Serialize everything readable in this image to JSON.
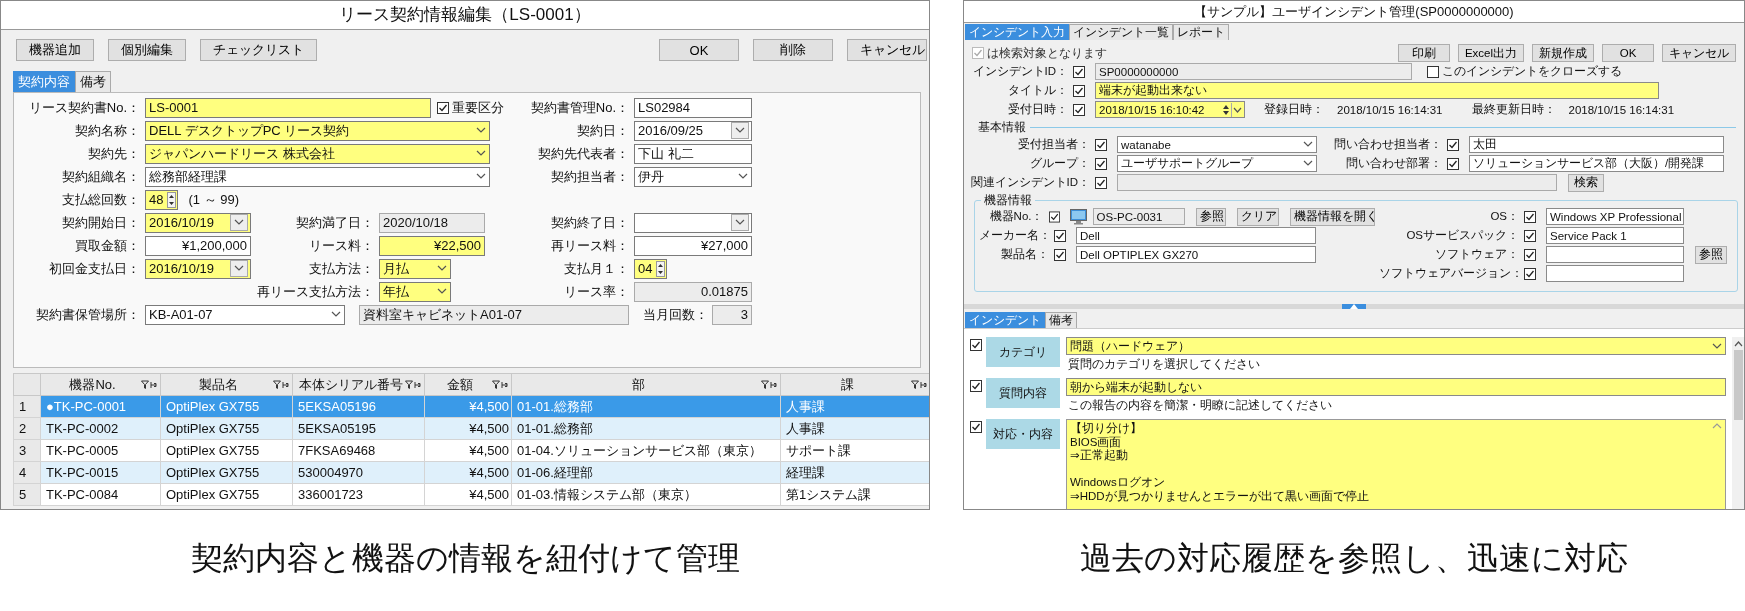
{
  "contract_window": {
    "title": "リース契約情報編集（LS-0001）",
    "toolbar_left": [
      "機器追加",
      "個別編集",
      "チェックリスト"
    ],
    "toolbar_right": [
      "OK",
      "削除",
      "キャンセル"
    ],
    "tabs": [
      {
        "label": "契約内容",
        "selected": true
      },
      {
        "label": "備考",
        "selected": false
      }
    ],
    "form_rows": [
      {
        "left": {
          "label": "リース契約書No.：",
          "field": {
            "kind": "text",
            "value": "LS-0001",
            "highlighted": true,
            "readonly": false
          },
          "flag": {
            "label": "重要区分",
            "checked": true
          }
        },
        "right": {
          "label": "契約書管理No.：",
          "field": {
            "kind": "text",
            "value": "LS02984",
            "highlighted": false,
            "readonly": false
          }
        }
      },
      {
        "left": {
          "label": "契約名称：",
          "field": {
            "kind": "combo",
            "value": "DELL  デスクトップPC  リース契約",
            "highlighted": true,
            "readonly": false
          }
        },
        "right": {
          "label": "契約日：",
          "field": {
            "kind": "date",
            "value": "2016/09/25",
            "highlighted": false,
            "readonly": false
          }
        }
      },
      {
        "left": {
          "label": "契約先：",
          "field": {
            "kind": "combo",
            "value": "ジャパンハードリース  株式会社",
            "highlighted": true,
            "readonly": false
          }
        },
        "right": {
          "label": "契約先代表者：",
          "field": {
            "kind": "text",
            "value": "下山  礼二",
            "highlighted": false,
            "readonly": false
          }
        }
      },
      {
        "left": {
          "label": "契約組織名：",
          "field": {
            "kind": "combo",
            "value": "総務部経理課",
            "highlighted": false,
            "readonly": false
          }
        },
        "right": {
          "label": "契約担当者：",
          "field": {
            "kind": "combo",
            "value": "伊丹",
            "highlighted": false,
            "readonly": false
          }
        }
      },
      {
        "left": {
          "label": "支払総回数：",
          "field": {
            "kind": "spin",
            "value": "48",
            "highlighted": true,
            "readonly": false
          },
          "note": "(1 ～ 99)"
        }
      },
      {
        "left": {
          "label": "契約開始日：",
          "field": {
            "kind": "date",
            "value": "2016/10/19",
            "highlighted": true,
            "readonly": false
          }
        },
        "middle": {
          "label": "契約満了日：",
          "field": {
            "kind": "text",
            "value": "2020/10/18",
            "highlighted": false,
            "readonly": true
          }
        },
        "right": {
          "label": "契約終了日：",
          "field": {
            "kind": "date",
            "highlighted": false,
            "readonly": false
          }
        }
      },
      {
        "left": {
          "label": "買取金額：",
          "field": {
            "kind": "amount",
            "value": "¥1,200,000",
            "highlighted": false,
            "readonly": false
          }
        },
        "middle": {
          "label": "リース料：",
          "field": {
            "kind": "amount",
            "value": "¥22,500",
            "highlighted": true,
            "readonly": false
          }
        },
        "right": {
          "label": "再リース料：",
          "field": {
            "kind": "amount",
            "value": "¥27,000",
            "highlighted": false,
            "readonly": false
          }
        }
      },
      {
        "left": {
          "label": "初回金支払日：",
          "field": {
            "kind": "date",
            "value": "2016/10/19",
            "highlighted": true,
            "readonly": false
          }
        },
        "middle": {
          "label": "支払方法：",
          "field": {
            "kind": "combo",
            "value": "月払",
            "highlighted": true,
            "readonly": false
          }
        },
        "right": {
          "label": "支払月１：",
          "field": {
            "kind": "spin",
            "value": "04",
            "highlighted": true,
            "readonly": false
          }
        }
      },
      {
        "middle": {
          "label": "再リース支払方法：",
          "field": {
            "kind": "combo",
            "value": "年払",
            "highlighted": true,
            "readonly": false
          }
        },
        "right": {
          "label": "リース率：",
          "field": {
            "kind": "amount",
            "value": "0.01875",
            "highlighted": false,
            "readonly": true
          }
        }
      },
      {
        "left": {
          "label": "契約書保管場所：",
          "field": {
            "kind": "combo",
            "value": "KB-A01-07",
            "highlighted": false,
            "readonly": false
          },
          "detail": {
            "kind": "text",
            "value": "資料室キャビネットA01-07",
            "highlighted": false,
            "readonly": true
          }
        },
        "right": {
          "label": "当月回数：",
          "field": {
            "kind": "amount",
            "value": "3",
            "highlighted": false,
            "readonly": true
          }
        }
      }
    ],
    "grid": {
      "columns": [
        "機器No.",
        "製品名",
        "本体シリアル番号",
        "金額",
        "部",
        "課"
      ],
      "rows": [
        {
          "number": "1",
          "selected": true,
          "cells": [
            "●TK-PC-0001",
            "OptiPlex GX755",
            "5EKSA05196",
            "¥4,500",
            "01-01.総務部",
            "人事課"
          ]
        },
        {
          "number": "2",
          "selected": false,
          "cells": [
            "TK-PC-0002",
            "OptiPlex GX755",
            "5EKSA05195",
            "¥4,500",
            "01-01.総務部",
            "人事課"
          ]
        },
        {
          "number": "3",
          "selected": false,
          "cells": [
            "TK-PC-0005",
            "OptiPlex GX755",
            "7FKSA69468",
            "¥4,500",
            "01-04.ソリューションサービス部（東京）",
            "サポート課"
          ]
        },
        {
          "number": "4",
          "selected": false,
          "cells": [
            "TK-PC-0015",
            "OptiPlex GX755",
            "530004970",
            "¥4,500",
            "01-06.経理部",
            "経理課"
          ]
        },
        {
          "number": "5",
          "selected": false,
          "cells": [
            "TK-PC-0084",
            "OptiPlex GX755",
            "336001723",
            "¥4,500",
            "01-03.情報システム部（東京）",
            "第1システム課"
          ]
        }
      ]
    }
  },
  "incident_window": {
    "title": "【サンプル】ユーザインシデント管理(SP0000000000)",
    "tabs": [
      {
        "label": "インシデント入力",
        "selected": true
      },
      {
        "label": "インシデント一覧",
        "selected": false
      },
      {
        "label": "レポート",
        "selected": false
      }
    ],
    "search_flag": {
      "label": "は検索対象となります",
      "checked": true,
      "disabled": true
    },
    "buttons": [
      "印刷",
      "Excel出力",
      "新規作成",
      "OK",
      "キャンセル"
    ],
    "id_row": {
      "label": "インシデントID：",
      "checked": true,
      "value": "SP0000000000",
      "close_option": {
        "label": "このインシデントをクローズする",
        "checked": false
      }
    },
    "title_row": {
      "label": "タイトル：",
      "checked": true,
      "value": "端末が起動出来ない"
    },
    "received_row": {
      "label": "受付日時：",
      "checked": true,
      "value": "2018/10/15 16:10:42",
      "registered_label": "登録日時：",
      "registered": "2018/10/15 16:14:31",
      "updated_label": "最終更新日時：",
      "updated": "2018/10/15 16:14:31"
    },
    "basic_info": {
      "legend": "基本情報",
      "rows": [
        {
          "left": {
            "label": "受付担当者：",
            "checked": true,
            "kind": "combo",
            "value": "watanabe"
          },
          "right": {
            "label": "問い合わせ担当者：",
            "checked": true,
            "kind": "text",
            "value": "太田"
          }
        },
        {
          "left": {
            "label": "グループ：",
            "checked": true,
            "kind": "combo",
            "value": "ユーザサポートグループ"
          },
          "right": {
            "label": "問い合わせ部署：",
            "checked": true,
            "kind": "text",
            "value": "ソリューションサービス部（大阪）/開発課"
          }
        },
        {
          "left": {
            "label": "関連インシデントID：",
            "checked": true,
            "kind": "readonly"
          },
          "button": "検索"
        }
      ]
    },
    "device_info": {
      "legend": "機器情報",
      "left": [
        {
          "label": "機器No.：",
          "checked": true,
          "kind": "device",
          "value": "OS-PC-0031",
          "buttons": [
            "参照",
            "クリア",
            "機器情報を開く"
          ]
        },
        {
          "label": "メーカー名：",
          "checked": true,
          "kind": "text",
          "value": "Dell"
        },
        {
          "label": "製品名：",
          "checked": true,
          "kind": "text",
          "value": "Dell OPTIPLEX GX270"
        }
      ],
      "right": [
        {
          "label": "OS：",
          "checked": true,
          "kind": "text",
          "value": "Windows XP Professional"
        },
        {
          "label": "OSサービスパック：",
          "checked": true,
          "kind": "text",
          "value": "Service Pack 1"
        },
        {
          "label": "ソフトウェア：",
          "checked": true,
          "kind": "text",
          "buttons": [
            "参照"
          ]
        },
        {
          "label": "ソフトウェアバージョン：",
          "checked": true,
          "kind": "text"
        }
      ]
    },
    "lower_tabs": [
      {
        "label": "インシデント",
        "selected": true
      },
      {
        "label": "備考",
        "selected": false
      }
    ],
    "entries": [
      {
        "label": "カテゴリ",
        "checked": true,
        "kind": "combo",
        "value": "問題（ハードウェア）",
        "hint": "質問のカテゴリを選択してください"
      },
      {
        "label": "質問内容",
        "checked": true,
        "kind": "text",
        "value": "朝から端末が起動しない",
        "hint": "この報告の内容を簡潔・明瞭に記述してください"
      },
      {
        "label": "対応・内容",
        "checked": true,
        "kind": "textarea",
        "value": "【切り分け】\nBIOS画面\n⇒正常起動\n\nWindowsログオン\n⇒HDDが見つかりませんとエラーが出て黒い画面で停止"
      }
    ]
  },
  "captions": [
    "契約内容と機器の情報を紐付けて管理",
    "過去の対応履歴を参照し、迅速に対応"
  ]
}
